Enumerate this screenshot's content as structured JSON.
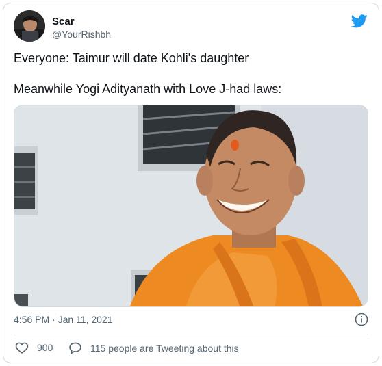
{
  "tweet": {
    "author_name": "Scar",
    "author_handle": "@YourRishbh",
    "line1": "Everyone: Taimur will date Kohli's daughter",
    "line2": "Meanwhile Yogi Adityanath with Love J-had laws:",
    "timestamp": "4:56 PM · Jan 11, 2021",
    "likes": "900",
    "conversation": "115 people are Tweeting about this"
  },
  "icons": {
    "brand": "twitter-bird-icon",
    "info": "info-icon",
    "like": "heart-icon",
    "reply": "speech-bubble-icon"
  },
  "colors": {
    "twitter_blue": "#1d9bf0",
    "secondary_text": "#536471",
    "border": "#cfd9de",
    "robe_saffron": "#ee8a22"
  }
}
